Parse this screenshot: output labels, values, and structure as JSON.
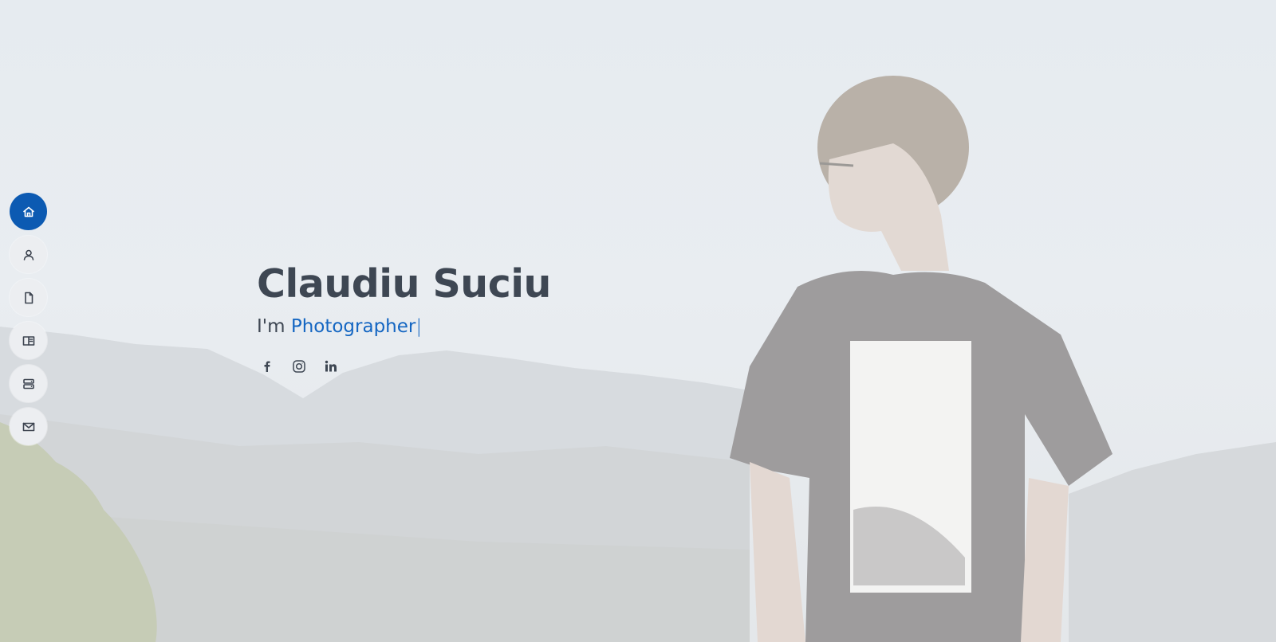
{
  "hero": {
    "name": "Claudiu Suciu",
    "tagline_prefix": "I'm",
    "role": "Photographer",
    "cursor": "|"
  },
  "nav": {
    "items": [
      {
        "icon": "home-icon",
        "active": true
      },
      {
        "icon": "user-icon",
        "active": false
      },
      {
        "icon": "file-icon",
        "active": false
      },
      {
        "icon": "book-icon",
        "active": false
      },
      {
        "icon": "server-icon",
        "active": false
      },
      {
        "icon": "envelope-icon",
        "active": false
      }
    ]
  },
  "socials": [
    {
      "icon": "facebook-icon"
    },
    {
      "icon": "instagram-icon"
    },
    {
      "icon": "linkedin-icon"
    }
  ],
  "colors": {
    "accent": "#0c5ab2",
    "heading": "#3e4753",
    "role": "#1466c2",
    "background": "#e9edf1"
  }
}
